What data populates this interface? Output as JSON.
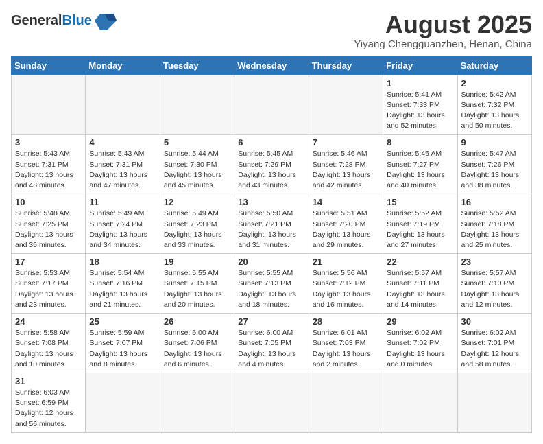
{
  "header": {
    "logo_line1": "General",
    "logo_line2": "Blue",
    "month_title": "August 2025",
    "subtitle": "Yiyang Chengguanzhen, Henan, China"
  },
  "weekdays": [
    "Sunday",
    "Monday",
    "Tuesday",
    "Wednesday",
    "Thursday",
    "Friday",
    "Saturday"
  ],
  "days": [
    {
      "date": "",
      "info": ""
    },
    {
      "date": "",
      "info": ""
    },
    {
      "date": "",
      "info": ""
    },
    {
      "date": "",
      "info": ""
    },
    {
      "date": "",
      "info": ""
    },
    {
      "date": "1",
      "info": "Sunrise: 5:41 AM\nSunset: 7:33 PM\nDaylight: 13 hours and 52 minutes."
    },
    {
      "date": "2",
      "info": "Sunrise: 5:42 AM\nSunset: 7:32 PM\nDaylight: 13 hours and 50 minutes."
    },
    {
      "date": "3",
      "info": "Sunrise: 5:43 AM\nSunset: 7:31 PM\nDaylight: 13 hours and 48 minutes."
    },
    {
      "date": "4",
      "info": "Sunrise: 5:43 AM\nSunset: 7:31 PM\nDaylight: 13 hours and 47 minutes."
    },
    {
      "date": "5",
      "info": "Sunrise: 5:44 AM\nSunset: 7:30 PM\nDaylight: 13 hours and 45 minutes."
    },
    {
      "date": "6",
      "info": "Sunrise: 5:45 AM\nSunset: 7:29 PM\nDaylight: 13 hours and 43 minutes."
    },
    {
      "date": "7",
      "info": "Sunrise: 5:46 AM\nSunset: 7:28 PM\nDaylight: 13 hours and 42 minutes."
    },
    {
      "date": "8",
      "info": "Sunrise: 5:46 AM\nSunset: 7:27 PM\nDaylight: 13 hours and 40 minutes."
    },
    {
      "date": "9",
      "info": "Sunrise: 5:47 AM\nSunset: 7:26 PM\nDaylight: 13 hours and 38 minutes."
    },
    {
      "date": "10",
      "info": "Sunrise: 5:48 AM\nSunset: 7:25 PM\nDaylight: 13 hours and 36 minutes."
    },
    {
      "date": "11",
      "info": "Sunrise: 5:49 AM\nSunset: 7:24 PM\nDaylight: 13 hours and 34 minutes."
    },
    {
      "date": "12",
      "info": "Sunrise: 5:49 AM\nSunset: 7:23 PM\nDaylight: 13 hours and 33 minutes."
    },
    {
      "date": "13",
      "info": "Sunrise: 5:50 AM\nSunset: 7:21 PM\nDaylight: 13 hours and 31 minutes."
    },
    {
      "date": "14",
      "info": "Sunrise: 5:51 AM\nSunset: 7:20 PM\nDaylight: 13 hours and 29 minutes."
    },
    {
      "date": "15",
      "info": "Sunrise: 5:52 AM\nSunset: 7:19 PM\nDaylight: 13 hours and 27 minutes."
    },
    {
      "date": "16",
      "info": "Sunrise: 5:52 AM\nSunset: 7:18 PM\nDaylight: 13 hours and 25 minutes."
    },
    {
      "date": "17",
      "info": "Sunrise: 5:53 AM\nSunset: 7:17 PM\nDaylight: 13 hours and 23 minutes."
    },
    {
      "date": "18",
      "info": "Sunrise: 5:54 AM\nSunset: 7:16 PM\nDaylight: 13 hours and 21 minutes."
    },
    {
      "date": "19",
      "info": "Sunrise: 5:55 AM\nSunset: 7:15 PM\nDaylight: 13 hours and 20 minutes."
    },
    {
      "date": "20",
      "info": "Sunrise: 5:55 AM\nSunset: 7:13 PM\nDaylight: 13 hours and 18 minutes."
    },
    {
      "date": "21",
      "info": "Sunrise: 5:56 AM\nSunset: 7:12 PM\nDaylight: 13 hours and 16 minutes."
    },
    {
      "date": "22",
      "info": "Sunrise: 5:57 AM\nSunset: 7:11 PM\nDaylight: 13 hours and 14 minutes."
    },
    {
      "date": "23",
      "info": "Sunrise: 5:57 AM\nSunset: 7:10 PM\nDaylight: 13 hours and 12 minutes."
    },
    {
      "date": "24",
      "info": "Sunrise: 5:58 AM\nSunset: 7:08 PM\nDaylight: 13 hours and 10 minutes."
    },
    {
      "date": "25",
      "info": "Sunrise: 5:59 AM\nSunset: 7:07 PM\nDaylight: 13 hours and 8 minutes."
    },
    {
      "date": "26",
      "info": "Sunrise: 6:00 AM\nSunset: 7:06 PM\nDaylight: 13 hours and 6 minutes."
    },
    {
      "date": "27",
      "info": "Sunrise: 6:00 AM\nSunset: 7:05 PM\nDaylight: 13 hours and 4 minutes."
    },
    {
      "date": "28",
      "info": "Sunrise: 6:01 AM\nSunset: 7:03 PM\nDaylight: 13 hours and 2 minutes."
    },
    {
      "date": "29",
      "info": "Sunrise: 6:02 AM\nSunset: 7:02 PM\nDaylight: 13 hours and 0 minutes."
    },
    {
      "date": "30",
      "info": "Sunrise: 6:02 AM\nSunset: 7:01 PM\nDaylight: 12 hours and 58 minutes."
    },
    {
      "date": "31",
      "info": "Sunrise: 6:03 AM\nSunset: 6:59 PM\nDaylight: 12 hours and 56 minutes."
    },
    {
      "date": "",
      "info": ""
    },
    {
      "date": "",
      "info": ""
    },
    {
      "date": "",
      "info": ""
    },
    {
      "date": "",
      "info": ""
    },
    {
      "date": "",
      "info": ""
    },
    {
      "date": "",
      "info": ""
    }
  ]
}
